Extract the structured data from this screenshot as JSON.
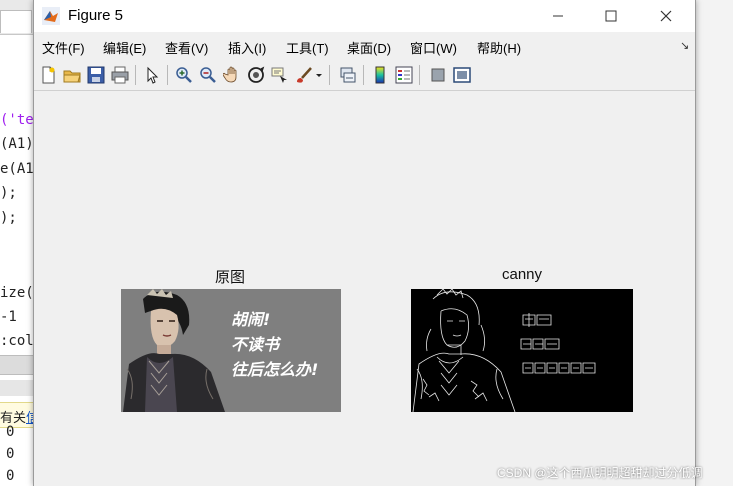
{
  "window": {
    "title": "Figure 5"
  },
  "menu": [
    "文件(F)",
    "编辑(E)",
    "查看(V)",
    "插入(I)",
    "工具(T)",
    "桌面(D)",
    "窗口(W)",
    "帮助(H)"
  ],
  "toolbar_icons": [
    "new-figure-icon",
    "open-folder-icon",
    "save-icon",
    "print-icon",
    "pointer-icon",
    "zoom-in-icon",
    "zoom-out-icon",
    "pan-hand-icon",
    "rotate-3d-icon",
    "data-cursor-icon",
    "brush-icon",
    "link-plot-icon",
    "colorbar-icon",
    "legend-icon",
    "hide-tools-icon",
    "show-tools-icon"
  ],
  "axes": [
    {
      "title": "原图",
      "caption_lines": [
        "胡闹!",
        "不读书",
        "往后怎么办!"
      ]
    },
    {
      "title": "canny"
    }
  ],
  "background_editor": {
    "code_lines": [
      "('te",
      "(A1)",
      "e(A1",
      ");",
      ");",
      "ize(",
      "-1",
      ":col"
    ],
    "notice_text": "有关",
    "notice_link": "信",
    "output_values": [
      "0",
      "0",
      "0"
    ]
  },
  "watermark": "CSDN @这个西瓜明明超甜却过分低调",
  "colors": {
    "titlebar": "#ffffff",
    "window_bg": "#f0f0f0",
    "image_gray": "#7f7f7f",
    "edge_bg": "#000000"
  }
}
